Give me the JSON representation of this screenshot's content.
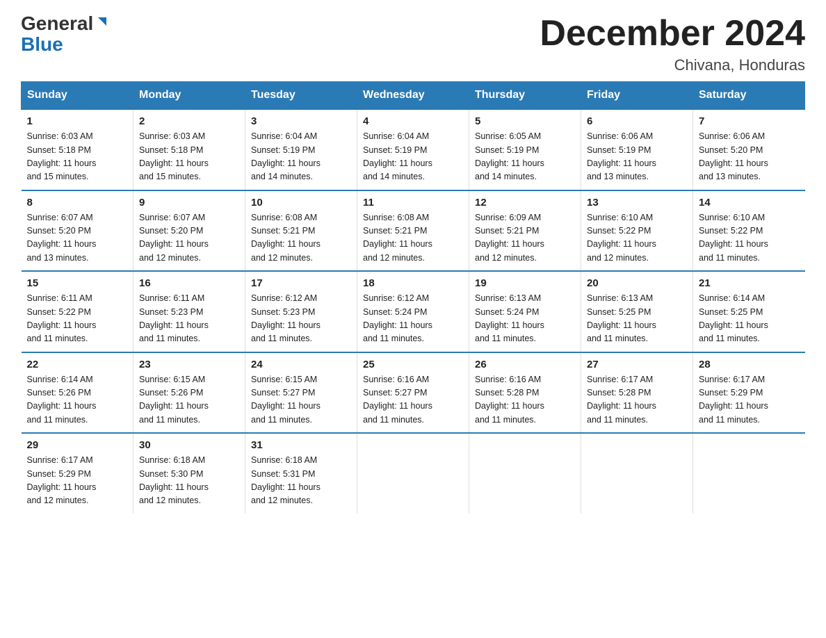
{
  "logo": {
    "line1": "General",
    "line2": "Blue"
  },
  "title": "December 2024",
  "subtitle": "Chivana, Honduras",
  "days_of_week": [
    "Sunday",
    "Monday",
    "Tuesday",
    "Wednesday",
    "Thursday",
    "Friday",
    "Saturday"
  ],
  "weeks": [
    [
      {
        "day": "1",
        "info": "Sunrise: 6:03 AM\nSunset: 5:18 PM\nDaylight: 11 hours\nand 15 minutes."
      },
      {
        "day": "2",
        "info": "Sunrise: 6:03 AM\nSunset: 5:18 PM\nDaylight: 11 hours\nand 15 minutes."
      },
      {
        "day": "3",
        "info": "Sunrise: 6:04 AM\nSunset: 5:19 PM\nDaylight: 11 hours\nand 14 minutes."
      },
      {
        "day": "4",
        "info": "Sunrise: 6:04 AM\nSunset: 5:19 PM\nDaylight: 11 hours\nand 14 minutes."
      },
      {
        "day": "5",
        "info": "Sunrise: 6:05 AM\nSunset: 5:19 PM\nDaylight: 11 hours\nand 14 minutes."
      },
      {
        "day": "6",
        "info": "Sunrise: 6:06 AM\nSunset: 5:19 PM\nDaylight: 11 hours\nand 13 minutes."
      },
      {
        "day": "7",
        "info": "Sunrise: 6:06 AM\nSunset: 5:20 PM\nDaylight: 11 hours\nand 13 minutes."
      }
    ],
    [
      {
        "day": "8",
        "info": "Sunrise: 6:07 AM\nSunset: 5:20 PM\nDaylight: 11 hours\nand 13 minutes."
      },
      {
        "day": "9",
        "info": "Sunrise: 6:07 AM\nSunset: 5:20 PM\nDaylight: 11 hours\nand 12 minutes."
      },
      {
        "day": "10",
        "info": "Sunrise: 6:08 AM\nSunset: 5:21 PM\nDaylight: 11 hours\nand 12 minutes."
      },
      {
        "day": "11",
        "info": "Sunrise: 6:08 AM\nSunset: 5:21 PM\nDaylight: 11 hours\nand 12 minutes."
      },
      {
        "day": "12",
        "info": "Sunrise: 6:09 AM\nSunset: 5:21 PM\nDaylight: 11 hours\nand 12 minutes."
      },
      {
        "day": "13",
        "info": "Sunrise: 6:10 AM\nSunset: 5:22 PM\nDaylight: 11 hours\nand 12 minutes."
      },
      {
        "day": "14",
        "info": "Sunrise: 6:10 AM\nSunset: 5:22 PM\nDaylight: 11 hours\nand 11 minutes."
      }
    ],
    [
      {
        "day": "15",
        "info": "Sunrise: 6:11 AM\nSunset: 5:22 PM\nDaylight: 11 hours\nand 11 minutes."
      },
      {
        "day": "16",
        "info": "Sunrise: 6:11 AM\nSunset: 5:23 PM\nDaylight: 11 hours\nand 11 minutes."
      },
      {
        "day": "17",
        "info": "Sunrise: 6:12 AM\nSunset: 5:23 PM\nDaylight: 11 hours\nand 11 minutes."
      },
      {
        "day": "18",
        "info": "Sunrise: 6:12 AM\nSunset: 5:24 PM\nDaylight: 11 hours\nand 11 minutes."
      },
      {
        "day": "19",
        "info": "Sunrise: 6:13 AM\nSunset: 5:24 PM\nDaylight: 11 hours\nand 11 minutes."
      },
      {
        "day": "20",
        "info": "Sunrise: 6:13 AM\nSunset: 5:25 PM\nDaylight: 11 hours\nand 11 minutes."
      },
      {
        "day": "21",
        "info": "Sunrise: 6:14 AM\nSunset: 5:25 PM\nDaylight: 11 hours\nand 11 minutes."
      }
    ],
    [
      {
        "day": "22",
        "info": "Sunrise: 6:14 AM\nSunset: 5:26 PM\nDaylight: 11 hours\nand 11 minutes."
      },
      {
        "day": "23",
        "info": "Sunrise: 6:15 AM\nSunset: 5:26 PM\nDaylight: 11 hours\nand 11 minutes."
      },
      {
        "day": "24",
        "info": "Sunrise: 6:15 AM\nSunset: 5:27 PM\nDaylight: 11 hours\nand 11 minutes."
      },
      {
        "day": "25",
        "info": "Sunrise: 6:16 AM\nSunset: 5:27 PM\nDaylight: 11 hours\nand 11 minutes."
      },
      {
        "day": "26",
        "info": "Sunrise: 6:16 AM\nSunset: 5:28 PM\nDaylight: 11 hours\nand 11 minutes."
      },
      {
        "day": "27",
        "info": "Sunrise: 6:17 AM\nSunset: 5:28 PM\nDaylight: 11 hours\nand 11 minutes."
      },
      {
        "day": "28",
        "info": "Sunrise: 6:17 AM\nSunset: 5:29 PM\nDaylight: 11 hours\nand 11 minutes."
      }
    ],
    [
      {
        "day": "29",
        "info": "Sunrise: 6:17 AM\nSunset: 5:29 PM\nDaylight: 11 hours\nand 12 minutes."
      },
      {
        "day": "30",
        "info": "Sunrise: 6:18 AM\nSunset: 5:30 PM\nDaylight: 11 hours\nand 12 minutes."
      },
      {
        "day": "31",
        "info": "Sunrise: 6:18 AM\nSunset: 5:31 PM\nDaylight: 11 hours\nand 12 minutes."
      },
      {
        "day": "",
        "info": ""
      },
      {
        "day": "",
        "info": ""
      },
      {
        "day": "",
        "info": ""
      },
      {
        "day": "",
        "info": ""
      }
    ]
  ]
}
